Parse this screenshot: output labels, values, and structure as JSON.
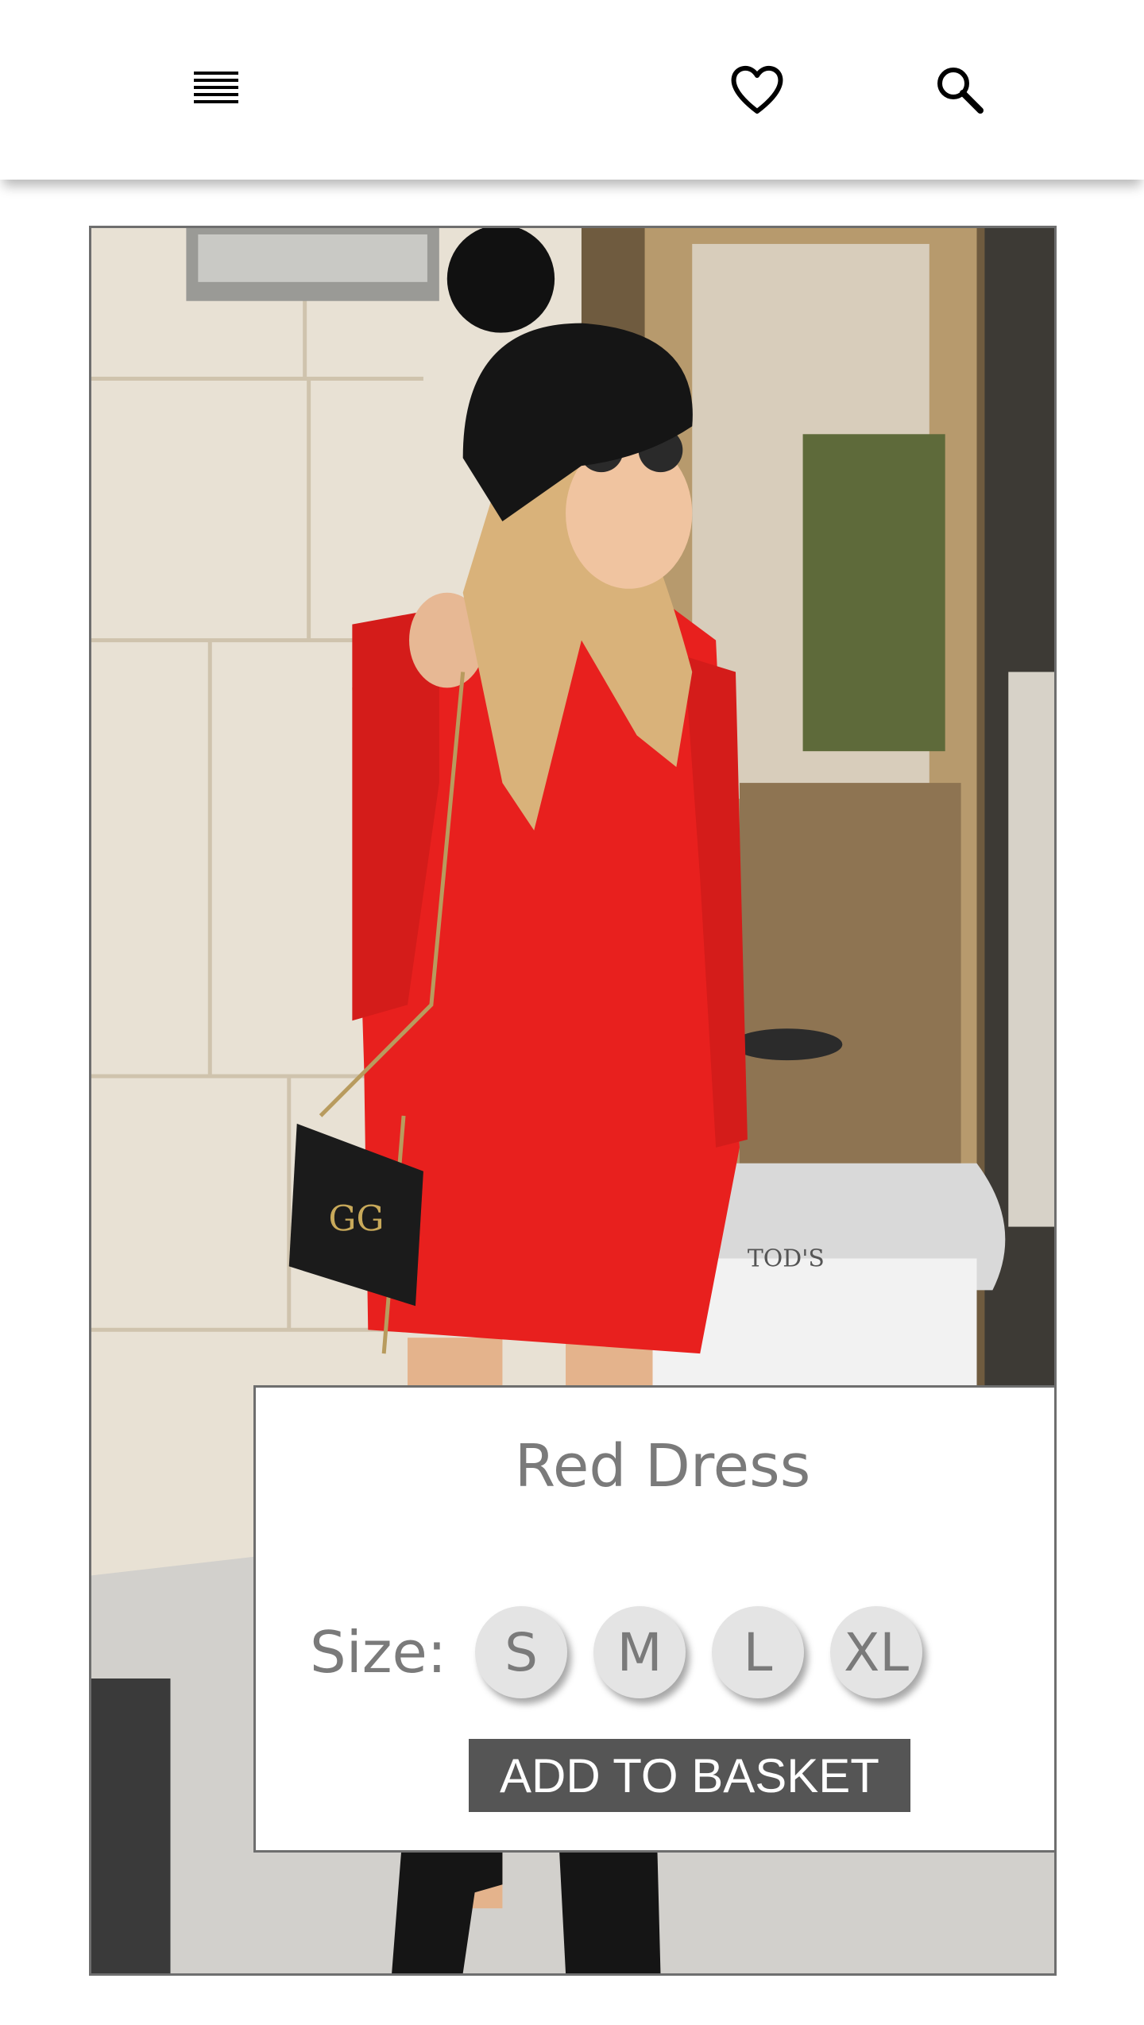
{
  "header": {
    "menu_icon": "menu-icon",
    "favorite_icon": "heart-icon",
    "search_icon": "search-icon"
  },
  "product": {
    "name": "Red Dress",
    "size_label": "Size:",
    "sizes": [
      "S",
      "M",
      "L",
      "XL"
    ],
    "add_to_basket_label": "ADD TO BASKET"
  },
  "colors": {
    "button_bg": "#555555",
    "text_gray": "#7a7a7a",
    "size_bubble": "#e4e4e4",
    "dress_red": "#e8201e"
  }
}
